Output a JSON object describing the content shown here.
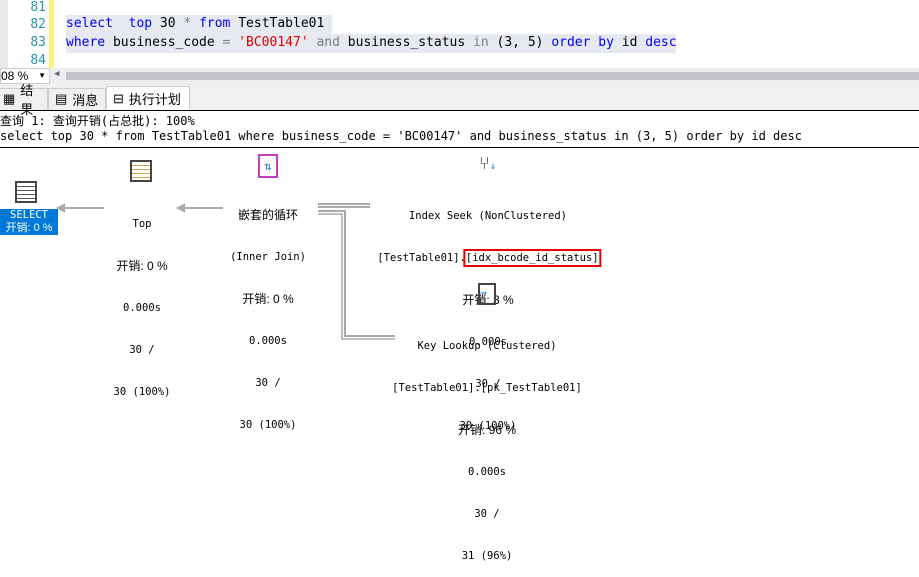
{
  "editor": {
    "lines": [
      {
        "num": "81",
        "text": ""
      },
      {
        "num": "82",
        "tokens": [
          [
            "kw",
            "select"
          ],
          [
            "",
            "  "
          ],
          [
            "kw",
            "top"
          ],
          [
            "",
            " 30 "
          ],
          [
            "gray",
            "*"
          ],
          [
            "",
            ""
          ],
          [
            "kw",
            " from"
          ],
          [
            "",
            " TestTable01"
          ]
        ]
      },
      {
        "num": "83",
        "tokens": [
          [
            "kw",
            "where"
          ],
          [
            "",
            " business_code "
          ],
          [
            "gray",
            "="
          ],
          [
            "",
            " "
          ],
          [
            "str",
            "'BC00147'"
          ],
          [
            "gray",
            " and"
          ],
          [
            "",
            " business_status "
          ],
          [
            "gray",
            "in"
          ],
          [
            "",
            " (3, 5) "
          ],
          [
            "kw",
            "order by"
          ],
          [
            "",
            " id "
          ],
          [
            "kw",
            "desc"
          ]
        ]
      },
      {
        "num": "84",
        "text": ""
      }
    ],
    "zoom": "08 %"
  },
  "tabs": [
    {
      "label": "结果",
      "icon": "grid-icon"
    },
    {
      "label": "消息",
      "icon": "messages-icon"
    },
    {
      "label": "执行计划",
      "icon": "execution-plan-icon",
      "active": true
    }
  ],
  "plan": {
    "query_header": "查询 1: 查询开销(占总批): 100%",
    "query_text": "select top 30 * from TestTable01 where business_code = 'BC00147' and business_status in (3, 5) order by id desc",
    "nodes": {
      "select": {
        "name": "SELECT",
        "cost": "开销: 0 %"
      },
      "top": {
        "name": "Top",
        "cost": "开销: 0 %",
        "time": "0.000s",
        "rows": "30 /",
        "est": "30 (100%)"
      },
      "loop": {
        "name": "嵌套的循环",
        "sub": "(Inner Join)",
        "cost": "开销: 0 %",
        "time": "0.000s",
        "rows": "30 /",
        "est": "30 (100%)"
      },
      "seek": {
        "name": "Index Seek (NonClustered)",
        "table": "[TestTable01].",
        "index": "[idx_bcode_id_status]",
        "cost": "开销: 3 %",
        "time": "0.000s",
        "rows": "30 /",
        "est": "30 (100%)"
      },
      "lookup": {
        "name": "Key Lookup (Clustered)",
        "table": "[TestTable01].[pk_TestTable01]",
        "cost": "开销: 96 %",
        "time": "0.000s",
        "rows": "30 /",
        "est": "31 (96%)"
      }
    },
    "highlight_color": "#e00000",
    "select_color": "#0078d7"
  }
}
